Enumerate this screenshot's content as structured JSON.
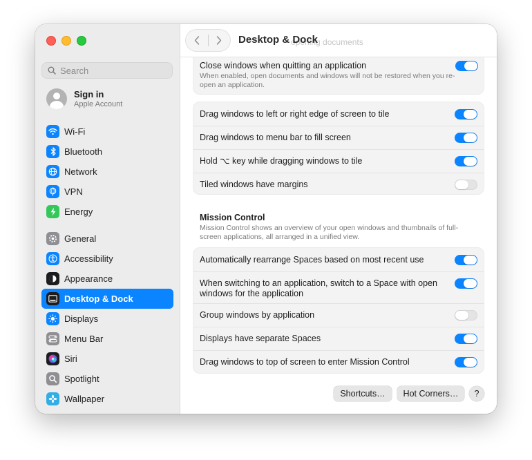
{
  "window": {
    "title": "Desktop & Dock",
    "ghost_text": "opening documents"
  },
  "search": {
    "placeholder": "Search"
  },
  "account": {
    "name": "Sign in",
    "subtitle": "Apple Account"
  },
  "sidebar": {
    "group1": [
      {
        "label": "Wi-Fi",
        "icon": "wifi-icon",
        "color": "#0a84ff"
      },
      {
        "label": "Bluetooth",
        "icon": "bluetooth-icon",
        "color": "#0a84ff"
      },
      {
        "label": "Network",
        "icon": "globe-icon",
        "color": "#0a84ff"
      },
      {
        "label": "VPN",
        "icon": "vpn-icon",
        "color": "#0a84ff"
      },
      {
        "label": "Energy",
        "icon": "bolt-icon",
        "color": "#34c759"
      }
    ],
    "group2": [
      {
        "label": "General",
        "icon": "gear-icon",
        "color": "#8e8e93"
      },
      {
        "label": "Accessibility",
        "icon": "accessibility-icon",
        "color": "#0a84ff"
      },
      {
        "label": "Appearance",
        "icon": "appearance-icon",
        "color": "#1d1d1f"
      },
      {
        "label": "Desktop & Dock",
        "icon": "dock-icon",
        "color": "#1d1d1f",
        "active": true
      },
      {
        "label": "Displays",
        "icon": "sun-icon",
        "color": "#0a84ff"
      },
      {
        "label": "Menu Bar",
        "icon": "menubar-icon",
        "color": "#8e8e93"
      },
      {
        "label": "Siri",
        "icon": "siri-icon",
        "color": "#5e5ce6"
      },
      {
        "label": "Spotlight",
        "icon": "spotlight-icon",
        "color": "#8e8e93"
      },
      {
        "label": "Wallpaper",
        "icon": "wallpaper-icon",
        "color": "#32ade6"
      }
    ]
  },
  "settings": {
    "close_windows": {
      "label": "Close windows when quitting an application",
      "desc": "When enabled, open documents and windows will not be restored when you re-open an application.",
      "on": true
    },
    "tiling": [
      {
        "label": "Drag windows to left or right edge of screen to tile",
        "on": true
      },
      {
        "label": "Drag windows to menu bar to fill screen",
        "on": true
      },
      {
        "label": "Hold ⌥ key while dragging windows to tile",
        "on": true
      },
      {
        "label": "Tiled windows have margins",
        "on": false
      }
    ],
    "mission_control": {
      "title": "Mission Control",
      "desc": "Mission Control shows an overview of your open windows and thumbnails of full-screen applications, all arranged in a unified view.",
      "items": [
        {
          "label": "Automatically rearrange Spaces based on most recent use",
          "on": true
        },
        {
          "label": "When switching to an application, switch to a Space with open windows for the application",
          "on": true
        },
        {
          "label": "Group windows by application",
          "on": false
        },
        {
          "label": "Displays have separate Spaces",
          "on": true
        },
        {
          "label": "Drag windows to top of screen to enter Mission Control",
          "on": true
        }
      ]
    }
  },
  "buttons": {
    "shortcuts": "Shortcuts…",
    "hot_corners": "Hot Corners…",
    "help": "?"
  },
  "colors": {
    "accent": "#0a84ff",
    "sidebar_bg": "#ececec"
  }
}
